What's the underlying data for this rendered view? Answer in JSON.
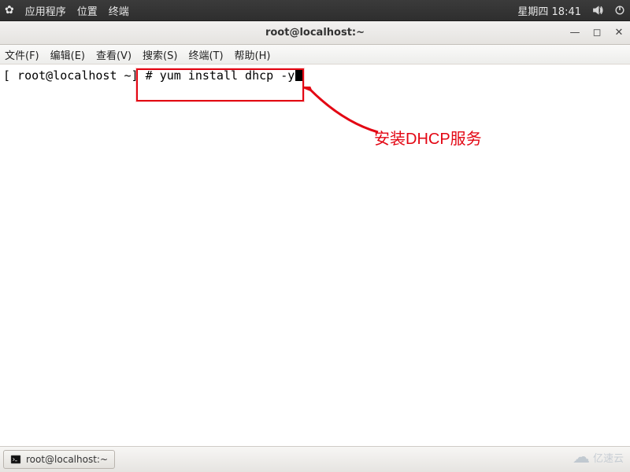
{
  "panel": {
    "menu_apps": "应用程序",
    "menu_places": "位置",
    "menu_terminal": "终端",
    "clock": "星期四 18:41"
  },
  "window": {
    "title": "root@localhost:~"
  },
  "menubar": {
    "file": "文件(F)",
    "edit": "编辑(E)",
    "view": "查看(V)",
    "search": "搜索(S)",
    "terminal": "终端(T)",
    "help": "帮助(H)"
  },
  "terminal": {
    "prompt": "[ root@localhost ~] # ",
    "command": "yum install dhcp -y"
  },
  "annotation": {
    "label": "安装DHCP服务"
  },
  "taskbar": {
    "task1": "root@localhost:~"
  },
  "watermark": {
    "brand": "亿速云",
    "bg": "https://blog.csd"
  }
}
